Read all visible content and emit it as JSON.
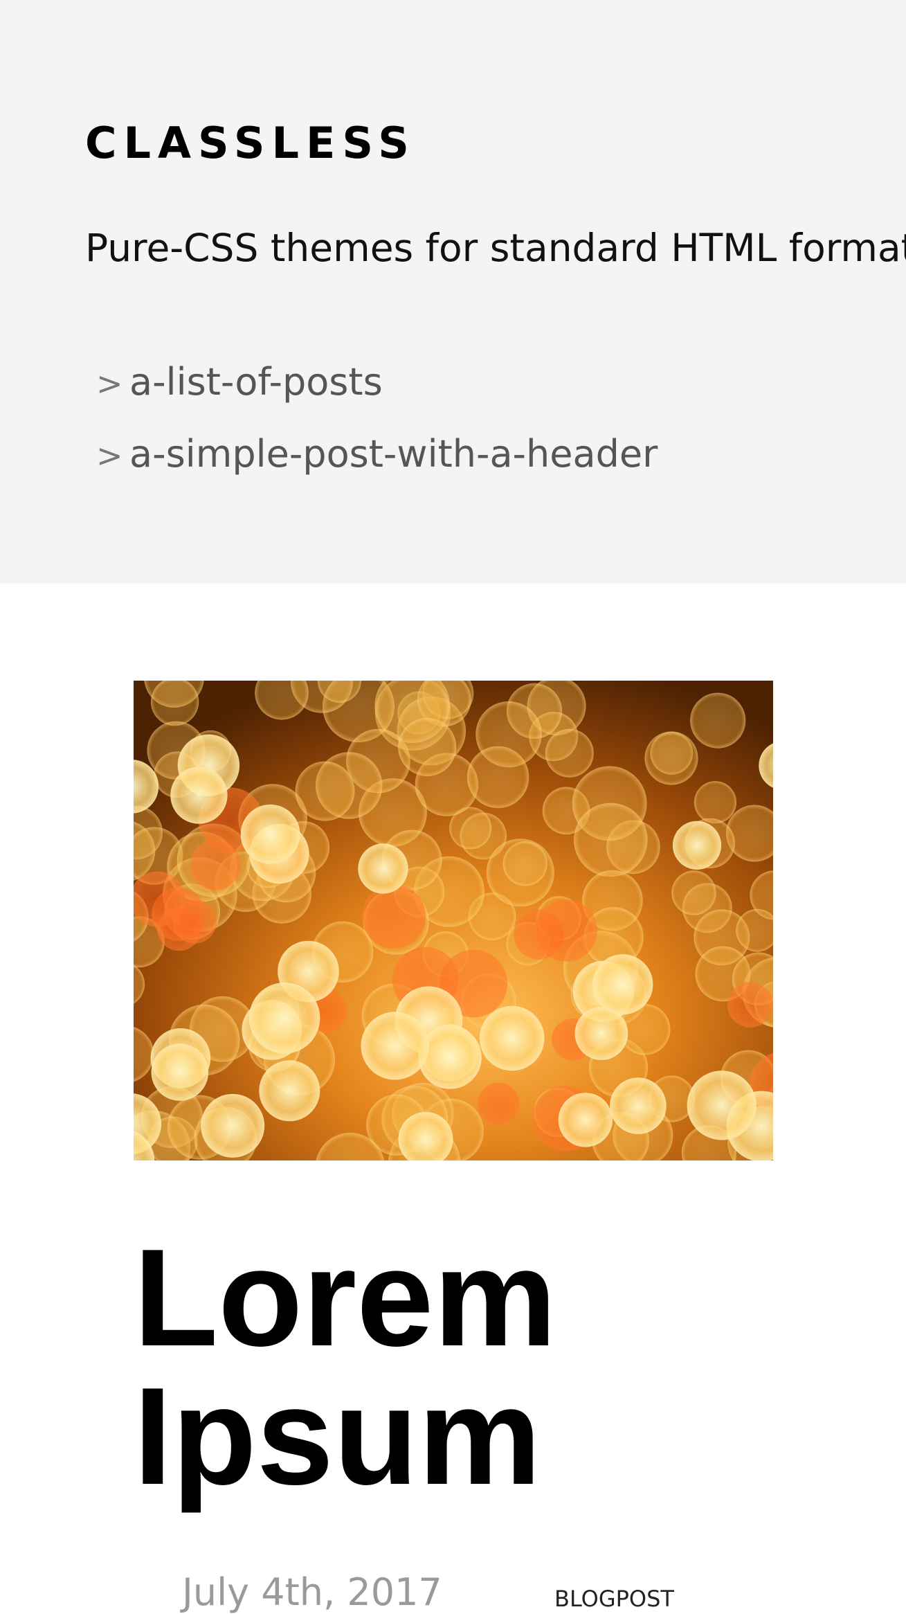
{
  "header": {
    "brand": "CLASSLESS",
    "tagline": "Pure-CSS themes for standard HTML formats.",
    "nav": [
      {
        "chevron": ">",
        "label": "a-list-of-posts"
      },
      {
        "chevron": ">",
        "label": "a-simple-post-with-a-header"
      }
    ]
  },
  "post": {
    "title_line1": "Lorem",
    "title_line2": "Ipsum",
    "date": "July 4th, 2017",
    "category": "BLOGPOST"
  },
  "colors": {
    "header_bg": "#f4f4f4",
    "hero_dominant": "#e07a10"
  }
}
